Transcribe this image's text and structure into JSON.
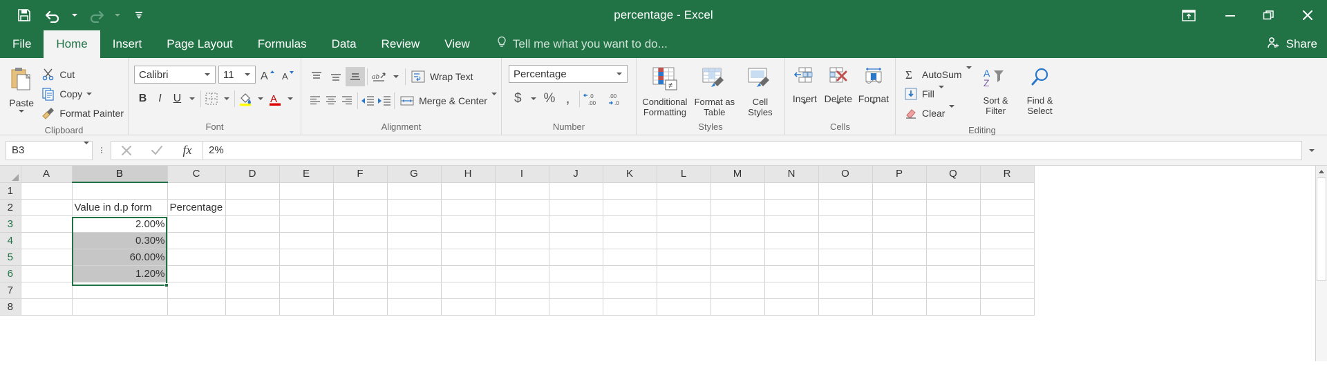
{
  "window": {
    "title": "percentage - Excel",
    "controls": {
      "ribbon_display_options": "ribbon-display-options",
      "minimize": "minimize",
      "restore": "restore",
      "close": "close"
    }
  },
  "quick_access": {
    "save": "Save",
    "undo": "Undo",
    "redo": "Redo",
    "customize": "Customize Quick Access Toolbar"
  },
  "tabs": [
    {
      "label": "File",
      "active": false
    },
    {
      "label": "Home",
      "active": true
    },
    {
      "label": "Insert",
      "active": false
    },
    {
      "label": "Page Layout",
      "active": false
    },
    {
      "label": "Formulas",
      "active": false
    },
    {
      "label": "Data",
      "active": false
    },
    {
      "label": "Review",
      "active": false
    },
    {
      "label": "View",
      "active": false
    }
  ],
  "tell_me": "Tell me what you want to do...",
  "share": "Share",
  "ribbon": {
    "clipboard": {
      "label": "Clipboard",
      "paste": "Paste",
      "cut": "Cut",
      "copy": "Copy",
      "format_painter": "Format Painter"
    },
    "font": {
      "label": "Font",
      "font_name": "Calibri",
      "font_size": "11",
      "grow_font": "A",
      "shrink_font": "A",
      "bold": "B",
      "italic": "I",
      "underline": "U"
    },
    "alignment": {
      "label": "Alignment",
      "wrap_text": "Wrap Text",
      "merge_center": "Merge & Center"
    },
    "number": {
      "label": "Number",
      "format": "Percentage",
      "accounting": "$",
      "percent_style": "%",
      "comma_style": ",",
      "increase_decimal": ".00",
      "decrease_decimal": ".00"
    },
    "styles": {
      "label": "Styles",
      "conditional_formatting": "Conditional\nFormatting",
      "conditional_formatting_l1": "Conditional",
      "conditional_formatting_l2": "Formatting",
      "format_as_table_l1": "Format as",
      "format_as_table_l2": "Table",
      "cell_styles_l1": "Cell",
      "cell_styles_l2": "Styles"
    },
    "cells": {
      "label": "Cells",
      "insert": "Insert",
      "delete": "Delete",
      "format": "Format"
    },
    "editing": {
      "label": "Editing",
      "autosum": "AutoSum",
      "fill": "Fill",
      "clear": "Clear",
      "sort_filter_l1": "Sort &",
      "sort_filter_l2": "Filter",
      "find_select_l1": "Find &",
      "find_select_l2": "Select"
    }
  },
  "formula_bar": {
    "name_box": "B3",
    "cancel": "cancel",
    "enter": "enter",
    "insert_function": "fx",
    "value": "2%"
  },
  "grid": {
    "columns": [
      "A",
      "B",
      "C",
      "D",
      "E",
      "F",
      "G",
      "H",
      "I",
      "J",
      "K",
      "L",
      "M",
      "N",
      "O",
      "P",
      "Q",
      "R"
    ],
    "selected_column": "B",
    "rows": [
      "1",
      "2",
      "3",
      "4",
      "5",
      "6",
      "7",
      "8"
    ],
    "selected_rows": [
      "3",
      "4",
      "5",
      "6"
    ],
    "cells": [
      {
        "ref": "B2",
        "value": "Value in d.p form",
        "align": "left",
        "overflow": true
      },
      {
        "ref": "C2",
        "value": "Percentage",
        "align": "left",
        "overflow": true
      },
      {
        "ref": "B3",
        "value": "2.00%",
        "align": "right"
      },
      {
        "ref": "B4",
        "value": "0.30%",
        "align": "right"
      },
      {
        "ref": "B5",
        "value": "60.00%",
        "align": "right"
      },
      {
        "ref": "B6",
        "value": "1.20%",
        "align": "right"
      }
    ],
    "selection_range": "B3:B6",
    "active_cell": "B3"
  },
  "colors": {
    "brand_green": "#217346",
    "ribbon_bg": "#f3f3f3",
    "header_bg": "#e6e6e6",
    "selection_fill": "#c6c6c6"
  }
}
